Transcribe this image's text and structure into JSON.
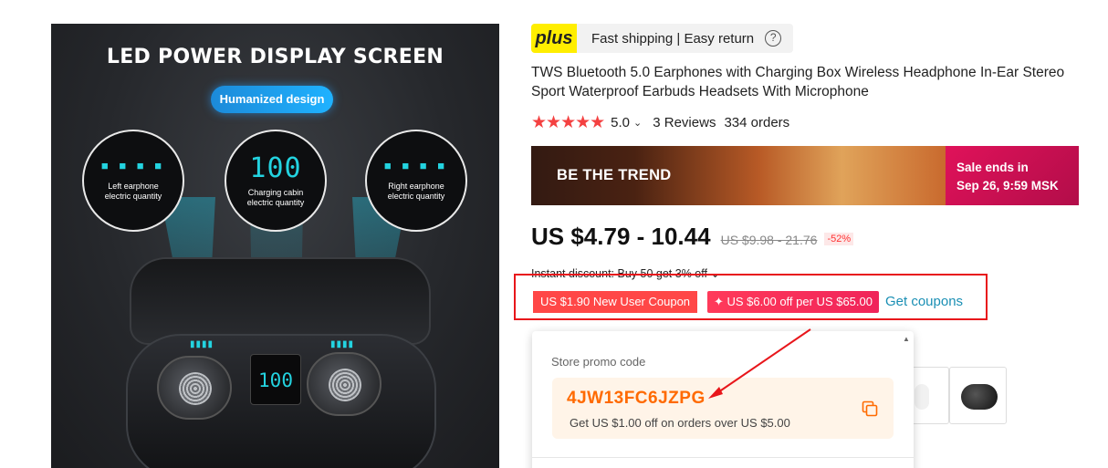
{
  "product_image": {
    "headline": "LED POWER DISPLAY SCREEN",
    "pill": "Humanized design",
    "circles": [
      {
        "symbol": "■ ■ ■ ■",
        "line1": "Left earphone",
        "line2": "electric quantity"
      },
      {
        "symbol": "100",
        "line1": "Charging cabin",
        "line2": "electric quantity"
      },
      {
        "symbol": "■ ■ ■ ■",
        "line1": "Right earphone",
        "line2": "electric quantity"
      }
    ],
    "case_display": "100",
    "case_dots": "▮▮▮▮"
  },
  "shipping_badge": {
    "logo": "plus",
    "text": "Fast shipping | Easy return",
    "help_icon": "?"
  },
  "title": "TWS Bluetooth 5.0 Earphones with Charging Box Wireless Headphone In-Ear Stereo Sport Waterproof Earbuds Headsets With Microphone",
  "rating": {
    "stars": "★★★★★",
    "value": "5.0",
    "chevron": "⌄",
    "reviews": "3 Reviews",
    "orders": "334 orders"
  },
  "banner": {
    "text": "BE THE TREND",
    "sale_line1": "Sale ends in",
    "sale_line2": "Sep 26, 9:59 MSK"
  },
  "price": {
    "current": "US $4.79 - 10.44",
    "original": "US $9.98 - 21.76",
    "discount": "-52%"
  },
  "instant_discount": "Instant discount: Buy 50 get 3% off ⌄",
  "coupons": {
    "new_user": "US $1.90 New User Coupon",
    "off": "✦ US $6.00 off per US $65.00",
    "get": "Get coupons"
  },
  "popup": {
    "label": "Store promo code",
    "code": "4JW13FC6JZPG",
    "desc": "Get US $1.00 off on orders over US $5.00"
  },
  "colors": {
    "accent_red": "#ff4747",
    "promo_orange": "#ff6a00",
    "link": "#1a8fb4",
    "highlight_box": "#e8161b"
  }
}
